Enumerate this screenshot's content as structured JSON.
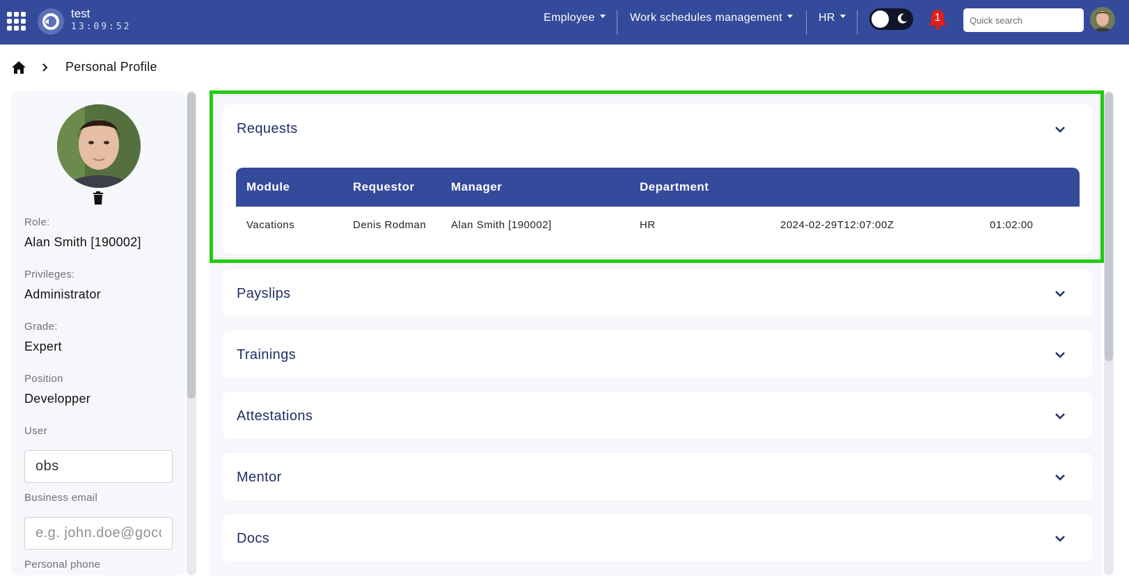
{
  "header": {
    "app_title": "test",
    "clock": "13:09:52",
    "menus": [
      {
        "label": "Employee"
      },
      {
        "label": "Work schedules management"
      },
      {
        "label": "HR"
      }
    ],
    "notification_count": "1",
    "search_placeholder": "Quick search",
    "accent_color": "#344a9a"
  },
  "breadcrumb": {
    "title": "Personal Profile"
  },
  "profile": {
    "fields": [
      {
        "label": "Role:",
        "value": "Alan Smith [190002]"
      },
      {
        "label": "Privileges:",
        "value": "Administrator"
      },
      {
        "label": "Grade:",
        "value": "Expert"
      },
      {
        "label": "Position",
        "value": "Developper"
      }
    ],
    "user": {
      "label": "User",
      "value": "obs"
    },
    "business_email": {
      "label": "Business email",
      "placeholder": "e.g. john.doe@gocompany.com"
    },
    "personal_phone": {
      "label": "Personal phone"
    }
  },
  "sections": {
    "requests": {
      "title": "Requests",
      "columns": [
        "Module",
        "Requestor",
        "Manager",
        "Department"
      ],
      "rows": [
        [
          "Vacations",
          "Denis Rodman",
          "Alan Smith [190002]",
          "HR",
          "2024-02-29T12:07:00Z",
          "01:02:00"
        ]
      ]
    },
    "payslips": {
      "title": "Payslips"
    },
    "trainings": {
      "title": "Trainings"
    },
    "attestations": {
      "title": "Attestations"
    },
    "mentor": {
      "title": "Mentor"
    },
    "docs": {
      "title": "Docs"
    }
  },
  "highlight_color": "#22cc11"
}
